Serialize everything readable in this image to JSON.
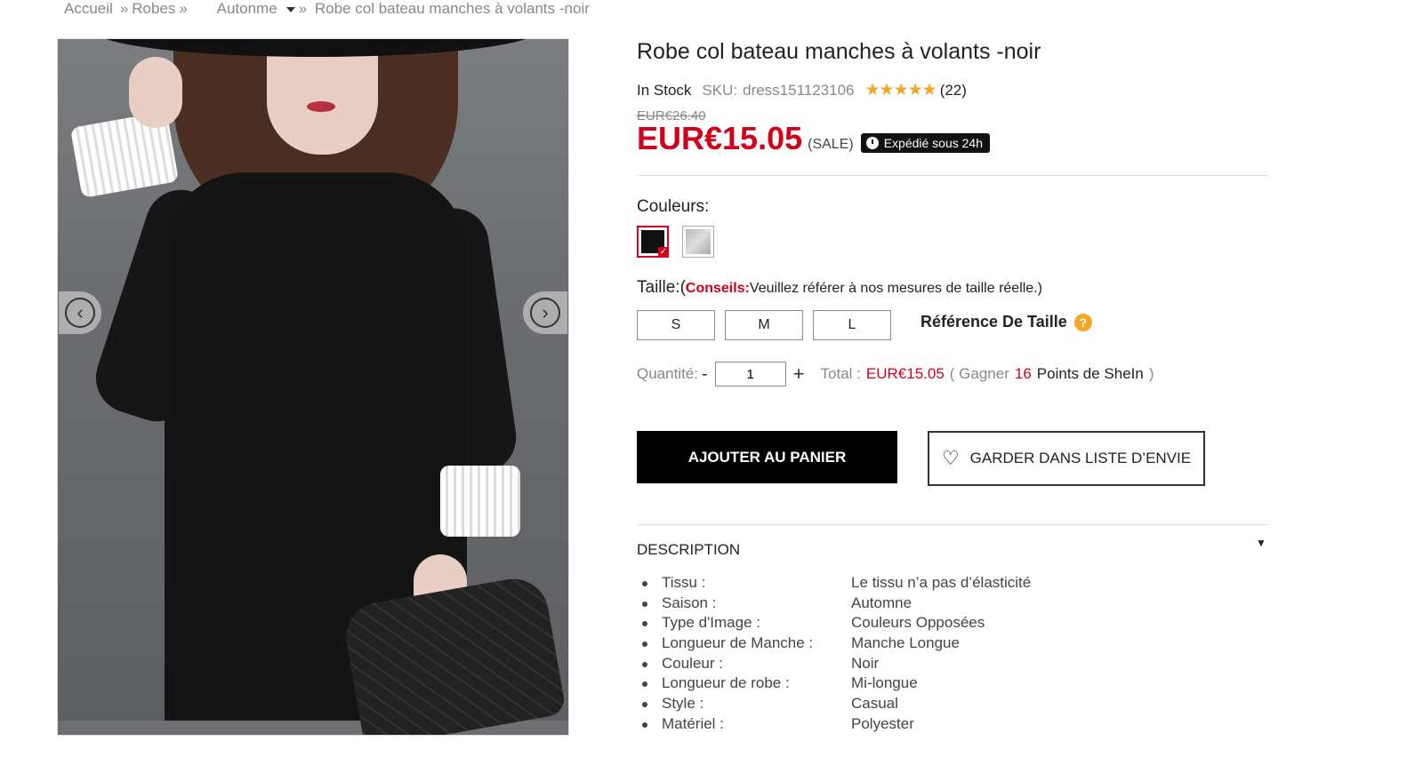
{
  "breadcrumb": {
    "home": "Accueil",
    "category": "Robes",
    "sub": "Autonme",
    "current": "Robe col bateau manches à volants -noir"
  },
  "product": {
    "title": "Robe col bateau manches à volants -noir",
    "stock": "In Stock",
    "sku_label": "SKU:",
    "sku": "dress151123106",
    "rating": 5,
    "stars": "★★★★★",
    "reviews": "(22)",
    "old_price": "EUR€26.40",
    "price": "EUR€15.05",
    "sale_label": "(SALE)",
    "shipping_badge": "Expédié sous 24h"
  },
  "colors": {
    "label": "Couleurs:",
    "options": [
      {
        "name": "noir",
        "hex": "#111111",
        "selected": true
      },
      {
        "name": "gris",
        "hex": "#bbbbbb",
        "selected": false
      }
    ]
  },
  "size": {
    "label": "Taille:(",
    "conseils": "Conseils:",
    "tip": "Veuillez référer à nos mesures de taille réelle.)",
    "options": [
      "S",
      "M",
      "L"
    ],
    "reference": "Référence De Taille",
    "reference_icon": "question-icon"
  },
  "quantity": {
    "label": "Quantité:",
    "minus": "-",
    "value": "1",
    "plus": "+",
    "total_label": "Total :",
    "total": "EUR€15.05",
    "earn_prefix": "( Gagner",
    "points": "16",
    "earn_suffix": "Points de SheIn",
    "close": ")"
  },
  "actions": {
    "add_to_cart": "AJOUTER AU PANIER",
    "wishlist": "GARDER DANS LISTE D’ENVIE"
  },
  "description": {
    "title": "DESCRIPTION",
    "items": [
      {
        "key": "Tissu :",
        "value": "Le tissu n’a pas d’élasticité"
      },
      {
        "key": "Saison :",
        "value": "Automne"
      },
      {
        "key": "Type d'Image :",
        "value": "Couleurs Opposées"
      },
      {
        "key": "Longueur de Manche :",
        "value": "Manche Longue"
      },
      {
        "key": "Couleur :",
        "value": "Noir"
      },
      {
        "key": "Longueur de robe :",
        "value": "Mi-longue"
      },
      {
        "key": "Style :",
        "value": "Casual"
      },
      {
        "key": "Matériel :",
        "value": "Polyester"
      }
    ]
  },
  "colors_theme": {
    "accent": "#d0021b",
    "star": "#f5a623"
  }
}
